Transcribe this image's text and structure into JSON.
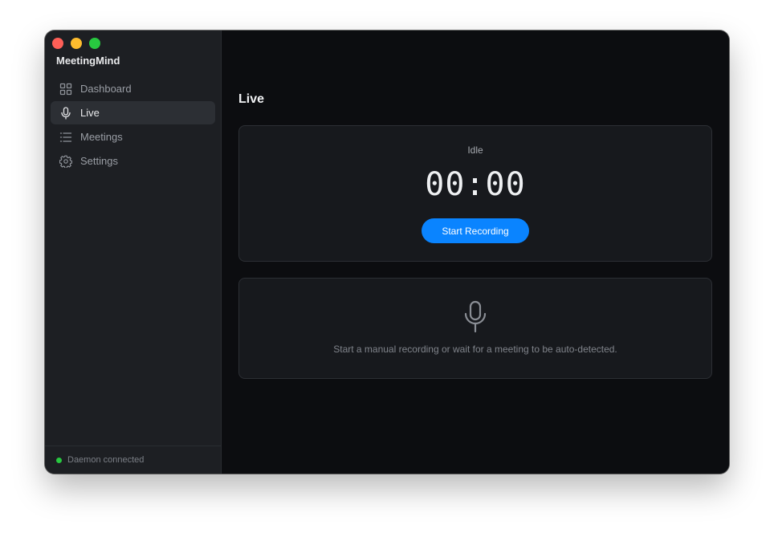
{
  "app": {
    "name": "MeetingMind"
  },
  "sidebar": {
    "items": [
      {
        "label": "Dashboard",
        "icon": "grid-icon",
        "active": false
      },
      {
        "label": "Live",
        "icon": "microphone-icon",
        "active": true
      },
      {
        "label": "Meetings",
        "icon": "list-icon",
        "active": false
      },
      {
        "label": "Settings",
        "icon": "gear-icon",
        "active": false
      }
    ],
    "footer": {
      "status_label": "Daemon connected",
      "status_color": "#28c840"
    }
  },
  "main": {
    "title": "Live",
    "recorder": {
      "status": "Idle",
      "timer": "00:00",
      "button_label": "Start Recording"
    },
    "empty_state": {
      "icon": "microphone-icon",
      "message": "Start a manual recording or wait for a meeting to be auto-detected."
    }
  },
  "colors": {
    "accent": "#0a84ff",
    "sidebar_bg": "#1d1f23",
    "main_bg": "#0c0d10"
  }
}
